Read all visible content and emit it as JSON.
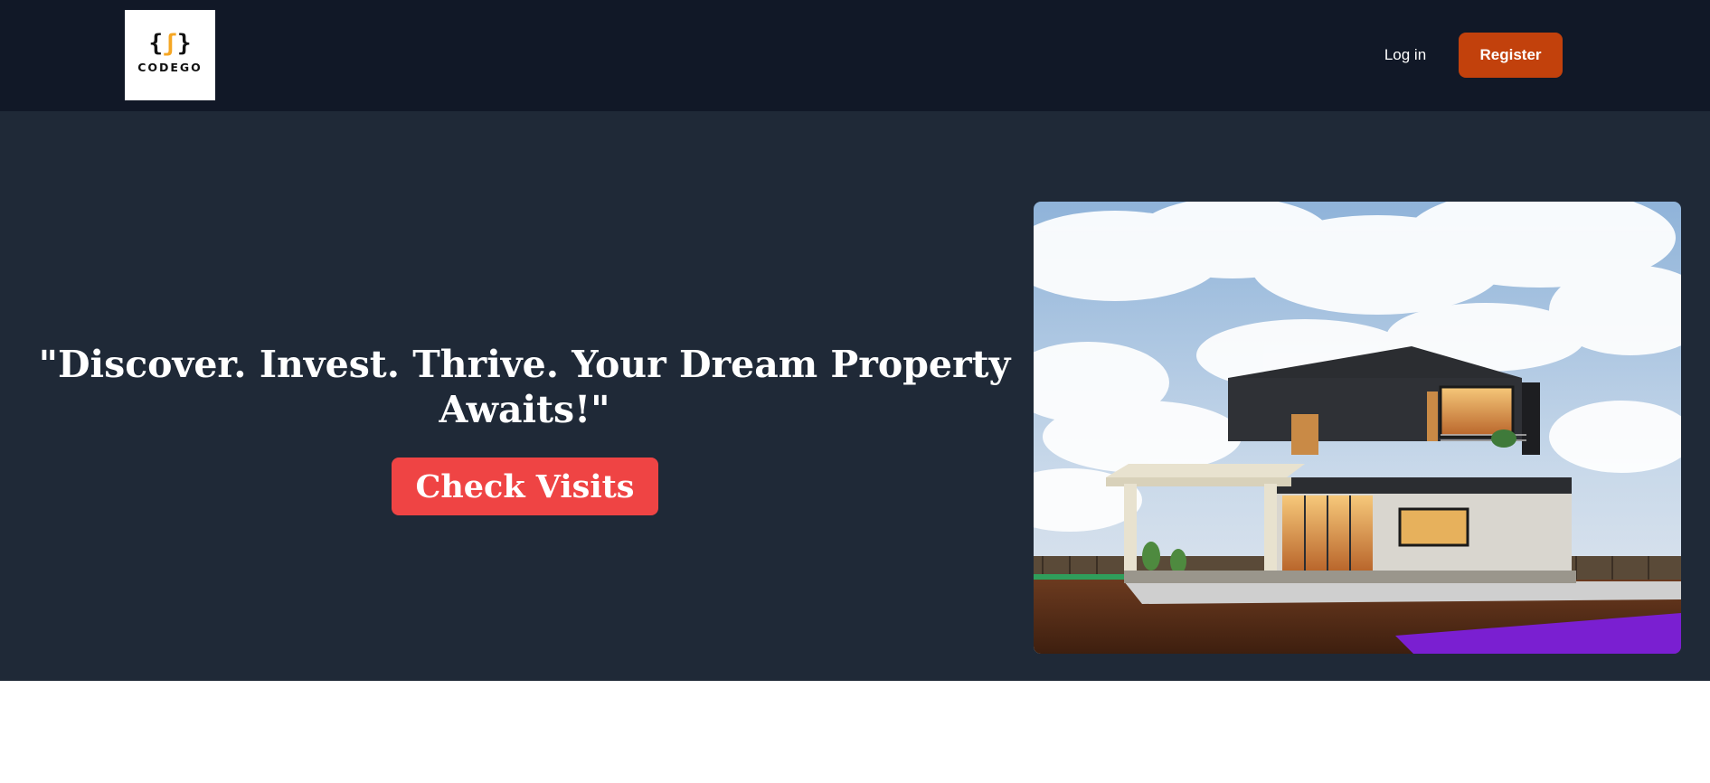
{
  "header": {
    "logo_text": "CODEGO",
    "login_label": "Log in",
    "register_label": "Register"
  },
  "hero": {
    "headline": "\"Discover. Invest. Thrive. Your Dream Property Awaits!\"",
    "cta_label": "Check Visits",
    "image_icon": "modern-house-photo"
  },
  "colors": {
    "header_bg": "#111827",
    "hero_bg": "#1f2937",
    "register_bg": "#c2410c",
    "cta_bg": "#ef4444"
  }
}
